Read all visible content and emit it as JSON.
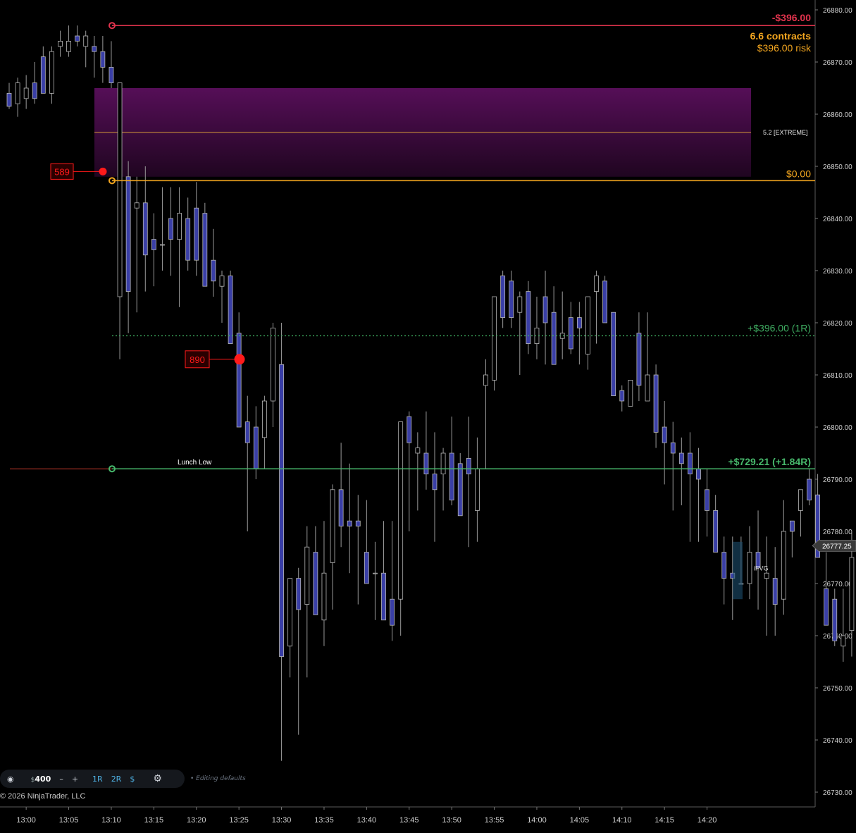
{
  "colors": {
    "background": "#000000",
    "up_body": "#000000",
    "down_body": "#3a3fa6",
    "wick": "#9a9a9a",
    "stop": "#e0334d",
    "entry": "#f3a61f",
    "target1": "#3fae62",
    "target2": "#47b96c",
    "zone": "#5a0f5c",
    "marker": "#ff1a1a"
  },
  "chart_data": {
    "type": "candlestick",
    "y_range": [
      26727,
      26881
    ],
    "y_ticks": [
      "26730.00",
      "26740.00",
      "26750.00",
      "26760.00",
      "26770.00",
      "26780.00",
      "26790.00",
      "26800.00",
      "26810.00",
      "26820.00",
      "26830.00",
      "26840.00",
      "26850.00",
      "26860.00",
      "26870.00",
      "26880.00"
    ],
    "x_ticks": [
      "13:00",
      "13:05",
      "13:10",
      "13:15",
      "13:20",
      "13:25",
      "13:30",
      "13:35",
      "13:40",
      "13:45",
      "13:50",
      "13:55",
      "14:00",
      "14:05",
      "14:10",
      "14:15",
      "14:20"
    ],
    "candles": [
      [
        26864,
        26866,
        26861,
        26861.5
      ],
      [
        26862,
        26867,
        26859.5,
        26866
      ],
      [
        26863,
        26867.5,
        26861,
        26865
      ],
      [
        26866,
        26870,
        26862,
        26863
      ],
      [
        26871,
        26873,
        26864,
        26864
      ],
      [
        26864,
        26873,
        26862,
        26872
      ],
      [
        26873,
        26876,
        26871,
        26874
      ],
      [
        26872,
        26877,
        26871,
        26874
      ],
      [
        26875,
        26877,
        26873,
        26874
      ],
      [
        26873,
        26876,
        26869,
        26875
      ],
      [
        26873,
        26875,
        26867,
        26872
      ],
      [
        26872,
        26875,
        26866,
        26869
      ],
      [
        26869,
        26874,
        26865,
        26866
      ],
      [
        26825,
        26866,
        26813,
        26866
      ],
      [
        26848,
        26851,
        26818,
        26826
      ],
      [
        26842,
        26848,
        26822,
        26843
      ],
      [
        26843,
        26850,
        26826,
        26833
      ],
      [
        26836,
        26841,
        26827,
        26834
      ],
      [
        26835,
        26846,
        26830,
        26835
      ],
      [
        26840,
        26846,
        26829,
        26836
      ],
      [
        26836,
        26846,
        26823,
        26841
      ],
      [
        26840,
        26844,
        26830,
        26832
      ],
      [
        26842,
        26847,
        26829,
        26832
      ],
      [
        26841,
        26843,
        26828,
        26827
      ],
      [
        26832,
        26838,
        26825,
        26828
      ],
      [
        26827,
        26830,
        26820,
        26829
      ],
      [
        26829,
        26830,
        26816,
        26816
      ],
      [
        26818,
        26822,
        26800,
        26800
      ],
      [
        26801,
        26806,
        26780,
        26797
      ],
      [
        26800,
        26804,
        26790,
        26792
      ],
      [
        26798,
        26806,
        26792,
        26805
      ],
      [
        26805,
        26820,
        26800,
        26819
      ],
      [
        26812,
        26820,
        26736,
        26756
      ],
      [
        26758,
        26771,
        26752,
        26771
      ],
      [
        26771,
        26773,
        26741,
        26765
      ],
      [
        26766,
        26781,
        26752,
        26777
      ],
      [
        26776,
        26781,
        26765,
        26764
      ],
      [
        26763,
        26782,
        26758,
        26772
      ],
      [
        26774,
        26789,
        26765,
        26788
      ],
      [
        26788,
        26797,
        26777,
        26781
      ],
      [
        26782,
        26793,
        26772,
        26781
      ],
      [
        26782,
        26787,
        26766,
        26781
      ],
      [
        26776,
        26786,
        26774,
        26770
      ],
      [
        26772,
        26778,
        26763,
        26772
      ],
      [
        26772,
        26782,
        26763,
        26763
      ],
      [
        26767,
        26782,
        26759,
        26762
      ],
      [
        26767,
        26798,
        26760,
        26801
      ],
      [
        26802,
        26803,
        26780,
        26797
      ],
      [
        26795,
        26799,
        26784,
        26796
      ],
      [
        26795,
        26803,
        26788,
        26791
      ],
      [
        26791,
        26799,
        26778,
        26788
      ],
      [
        26791,
        26796,
        26784,
        26795
      ],
      [
        26795,
        26802,
        26785,
        26786
      ],
      [
        26793,
        26795,
        26784,
        26783
      ],
      [
        26794,
        26802,
        26777,
        26791
      ],
      [
        26784,
        26798,
        26778,
        26792
      ],
      [
        26808,
        26813,
        26792,
        26810
      ],
      [
        26809,
        26824,
        26807,
        26825
      ],
      [
        26829,
        26830,
        26819,
        26821
      ],
      [
        26828,
        26830,
        26819,
        26821
      ],
      [
        26822,
        26826,
        26810,
        26825
      ],
      [
        26826,
        26828,
        26814,
        26816
      ],
      [
        26816,
        26825,
        26813,
        26819
      ],
      [
        26825,
        26830,
        26812,
        26820
      ],
      [
        26822,
        26827,
        26812,
        26812
      ],
      [
        26817,
        26826,
        26813,
        26818
      ],
      [
        26821,
        26824,
        26814,
        26815
      ],
      [
        26821,
        26824,
        26812,
        26819
      ],
      [
        26814,
        26822,
        26811,
        26825
      ],
      [
        26826,
        26830,
        26816,
        26829
      ],
      [
        26828,
        26829,
        26820,
        26820
      ],
      [
        26822,
        26819,
        26806,
        26806
      ],
      [
        26807,
        26808,
        26803,
        26805
      ],
      [
        26804,
        26807,
        26805,
        26809
      ],
      [
        26818,
        26822,
        26805,
        26808
      ],
      [
        26805,
        26822,
        26807,
        26810
      ],
      [
        26810,
        26812,
        26796,
        26799
      ],
      [
        26800,
        26805,
        26789,
        26797
      ],
      [
        26797,
        26801,
        26784,
        26795
      ],
      [
        26795,
        26798,
        26785,
        26793
      ],
      [
        26795,
        26799,
        26778,
        26791
      ],
      [
        26792,
        26796,
        26778,
        26790
      ],
      [
        26788,
        26792,
        26779,
        26784
      ],
      [
        26784,
        26787,
        26776,
        26776
      ],
      [
        26776,
        26779,
        26766,
        26771
      ],
      [
        26772,
        26779,
        26763,
        26771
      ],
      [
        26770,
        26779,
        26770,
        26770
      ],
      [
        26770,
        26781,
        26767,
        26776
      ],
      [
        26776,
        26784,
        26765,
        26773
      ],
      [
        26771,
        26779,
        26760,
        26772
      ],
      [
        26771,
        26777,
        26760,
        26766
      ],
      [
        26767,
        26786,
        26764,
        26780
      ],
      [
        26782,
        26781,
        26775,
        26780
      ],
      [
        26784,
        26788,
        26779,
        26788
      ],
      [
        26790,
        26792,
        26785,
        26786
      ],
      [
        26787,
        26791,
        26775,
        26775
      ],
      [
        26769,
        26776,
        26764,
        26762
      ],
      [
        26767,
        26769,
        26758,
        26759
      ],
      [
        26758,
        26769,
        26755,
        26760
      ],
      [
        26761,
        26780,
        26756,
        26775
      ]
    ]
  },
  "levels": {
    "stop": {
      "label": "-$396.00",
      "contracts": "6.6 contracts",
      "risk": "$396.00 risk",
      "price": 26877
    },
    "entry": {
      "label": "$0.00",
      "price": 26847.25
    },
    "target1": {
      "label": "+$396.00 (1R)",
      "price": 26817.5
    },
    "target2": {
      "label": "+$729.21 (+1.84R)",
      "price": 26792
    },
    "extreme": {
      "label": "5.2 [EXTREME]",
      "price": 26856.5
    },
    "zone_top": 26865,
    "zone_bottom": 26848
  },
  "annotations": {
    "lunch_low": "Lunch Low",
    "ifvg": "iFVG",
    "marker1": "589",
    "marker2": "890",
    "current_price": "26777.25",
    "marker1_price": 26849,
    "marker2_price": 26813
  },
  "toolbar": {
    "target_icon": "◉",
    "amount_symbol": "$",
    "amount": "400",
    "minus": "–",
    "plus": "+",
    "r1": "1R",
    "r2": "2R",
    "dollar": "$",
    "settings_icon": "⚙",
    "status": "• Editing defaults"
  },
  "footer": {
    "copyright": "© 2026 NinjaTrader, LLC"
  }
}
